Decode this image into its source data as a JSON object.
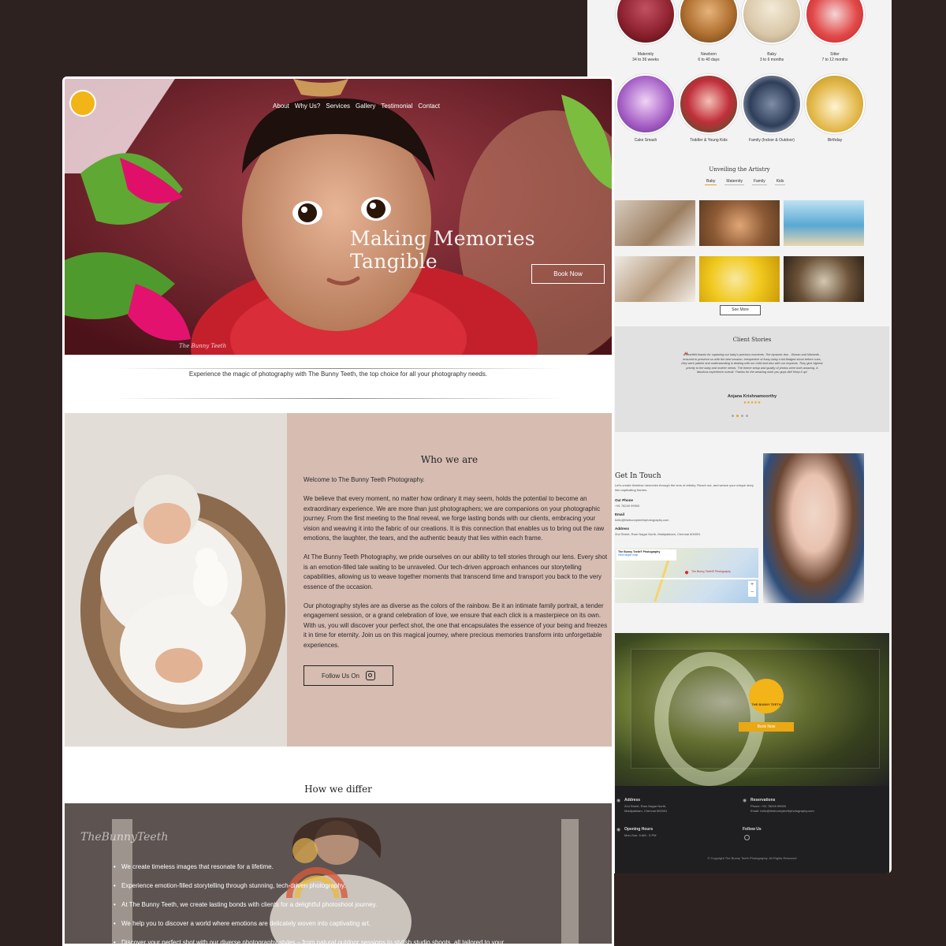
{
  "categories": [
    {
      "name": "Maternity",
      "sub": "34 to 36 weeks"
    },
    {
      "name": "Newborn",
      "sub": "6 to 40 days"
    },
    {
      "name": "Baby",
      "sub": "3 to 6 months"
    },
    {
      "name": "Sitter",
      "sub": "7 to 12 months"
    },
    {
      "name": "Cake Smash",
      "sub": ""
    },
    {
      "name": "Toddler & Young Kids",
      "sub": ""
    },
    {
      "name": "Family (Indoor & Outdoor)",
      "sub": ""
    },
    {
      "name": "Birthday",
      "sub": ""
    }
  ],
  "artistry": {
    "title": "Unveiling the Artistry",
    "tabs": [
      "Baby",
      "Maternity",
      "Family",
      "Kids"
    ],
    "see_more": "See More"
  },
  "stories": {
    "title": "Client Stories",
    "quote": "A heartfelt thanks for capturing our baby's precious moments. The dynamic duo - Simran and Nishanth - ensured to preserve us with the best session. Irrespective of fussy baby a full-fledged shoot before cues, they were patient and understanding in dealing with our child and also with our requests. They give highest priority to the baby and mother needs. The theme setup and quality of photos were both amazing. A fabulous experience overall. Thanks for the amazing work you guys did! Keep it up!",
    "author": "Anjana Krishnamoorthy",
    "stars": "★★★★★"
  },
  "contact": {
    "title": "Get In Touch",
    "intro": "Let's create timeless memories through the lens of artistry. Reach out, and weave your unique story into captivating frames.",
    "phone_label": "Our Phone",
    "phone": "+91 78249 99900",
    "email_label": "Email",
    "email": "hello@thebunnyteethphotography.com",
    "address_label": "Address",
    "address": "2nd Street, Ram Nagar North, Madipakkam, Chennai 600091",
    "map_title": "The Bunny Teeth® Photography",
    "map_link": "View larger map",
    "map_pin": "The Bunny Teeth® Photography"
  },
  "banner": {
    "logo": "THE BUNNY TEETH",
    "button": "Book Now"
  },
  "footer": {
    "address_label": "Address",
    "address": "2nd Street, Ram Nagar North, Madipakkam, Chennai 600091",
    "reservations_label": "Reservations",
    "phone": "Phone: +91 78249 99900",
    "email": "Email: hello@thebunnyteethphotography.com",
    "hours_label": "Opening Hours",
    "hours": "Mon-Sun: 9 AM - 5 PM",
    "follow_label": "Follow Us",
    "copyright": "© Copyright The Bunny Teeth Photography. All Rights Reserved"
  },
  "nav": [
    "About",
    "Why Us?",
    "Services",
    "Gallery",
    "Testimonial",
    "Contact"
  ],
  "hero": {
    "title": "Making Memories Tangible",
    "button": "Book Now",
    "watermark": "The Bunny Teeth"
  },
  "tagline": "Experience the magic of photography with The Bunny Teeth, the top choice for all your photography needs.",
  "who": {
    "title": "Who we are",
    "p1": "Welcome to The Bunny Teeth Photography.",
    "p2": "We believe that every moment, no matter how ordinary it may seem, holds the potential to become an extraordinary experience. We are more than just photographers; we are companions on your photographic journey. From the first meeting to the final reveal, we forge lasting bonds with our clients, embracing your vision and weaving it into the fabric of our creations. It is this connection that enables us to bring out the raw emotions, the laughter, the tears, and the authentic beauty that lies within each frame.",
    "p3": "At The Bunny Teeth Photography, we pride ourselves on our ability to tell stories through our lens. Every shot is an emotion-filled tale waiting to be unraveled. Our tech-driven approach enhances our storytelling capabilities, allowing us to weave together moments that transcend time and transport you back to the very essence of the occasion.",
    "p4": "Our photography styles are as diverse as the colors of the rainbow. Be it an intimate family portrait, a tender engagement session, or a grand celebration of love, we ensure that each click is a masterpiece on its own. With us, you will discover your perfect shot, the one that encapsulates the essence of your being and freezes it in time for eternity. Join us on this magical journey, where precious memories transform into unforgettable experiences.",
    "follow": "Follow Us On"
  },
  "differ": {
    "title": "How we differ",
    "items": [
      "We create timeless images that resonate for a lifetime.",
      "Experience emotion-filled storytelling through stunning, tech-driven photography.",
      "At The Bunny Teeth, we create lasting bonds with clients for a delightful photoshoot journey.",
      "We help you to discover a world where emotions are delicately woven into captivating art.",
      "Discover your perfect shot with our diverse photography styles – from natural outdoor sessions to stylish studio shoots, all tailored to your"
    ]
  }
}
